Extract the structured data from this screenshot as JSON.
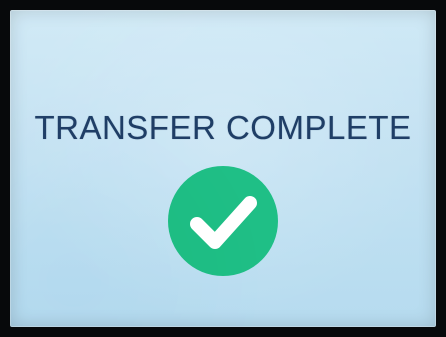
{
  "screen": {
    "title": "TRANSFER COMPLETE",
    "status_icon": "check-circle-icon",
    "colors": {
      "bezel": "#07090b",
      "background": "#c6e3f3",
      "title_text": "#1f3e66",
      "icon_fill": "#1fbf86",
      "icon_check": "#ffffff"
    }
  }
}
